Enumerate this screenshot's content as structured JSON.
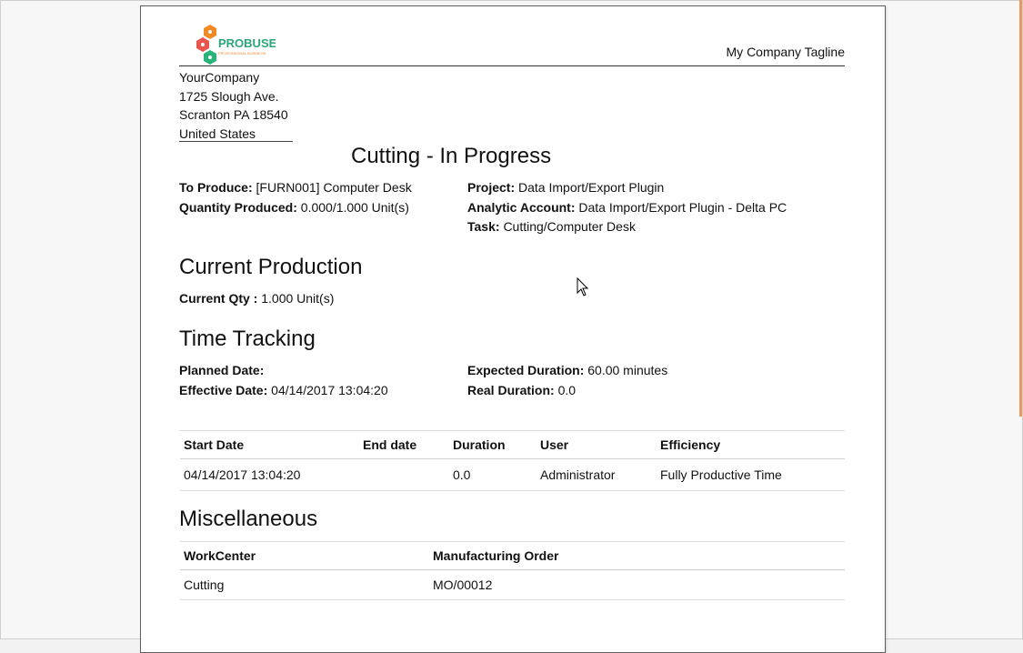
{
  "header": {
    "logo_text": "PROBUSE",
    "logo_subtext": "PROFESSIONAL BUSINESS",
    "tagline": "My Company Tagline"
  },
  "address": [
    "YourCompany",
    "1725 Slough Ave.",
    "Scranton PA 18540",
    "United States"
  ],
  "title": "Cutting - In Progress",
  "details": {
    "to_produce_label": "To Produce:",
    "to_produce_value": "[FURN001] Computer Desk",
    "qty_produced_label": "Quantity Produced:",
    "qty_produced_value": "0.000/1.000 Unit(s)",
    "project_label": "Project:",
    "project_value": "Data Import/Export Plugin",
    "analytic_label": "Analytic Account:",
    "analytic_value": "Data Import/Export Plugin - Delta PC",
    "task_label": "Task:",
    "task_value": "Cutting/Computer Desk"
  },
  "current_production": {
    "heading": "Current Production",
    "qty_label": "Current Qty :",
    "qty_value": "1.000 Unit(s)"
  },
  "time_tracking": {
    "heading": "Time Tracking",
    "planned_label": "Planned Date:",
    "planned_value": "",
    "effective_label": "Effective Date:",
    "effective_value": "04/14/2017 13:04:20",
    "expected_label": "Expected Duration:",
    "expected_value": "60.00 minutes",
    "real_label": "Real Duration:",
    "real_value": "0.0",
    "table": {
      "headers": [
        "Start Date",
        "End date",
        "Duration",
        "User",
        "Efficiency"
      ],
      "rows": [
        [
          "04/14/2017 13:04:20",
          "",
          "0.0",
          "Administrator",
          "Fully Productive Time"
        ]
      ]
    }
  },
  "misc": {
    "heading": "Miscellaneous",
    "table": {
      "headers": [
        "WorkCenter",
        "Manufacturing Order"
      ],
      "rows": [
        [
          "Cutting",
          "MO/00012"
        ]
      ]
    }
  },
  "colors": {
    "logo_orange": "#f08a24",
    "logo_red": "#e8554e",
    "logo_green": "#27b37a",
    "logo_text_green": "#2aa776",
    "scroll_accent": "#e59a62"
  }
}
